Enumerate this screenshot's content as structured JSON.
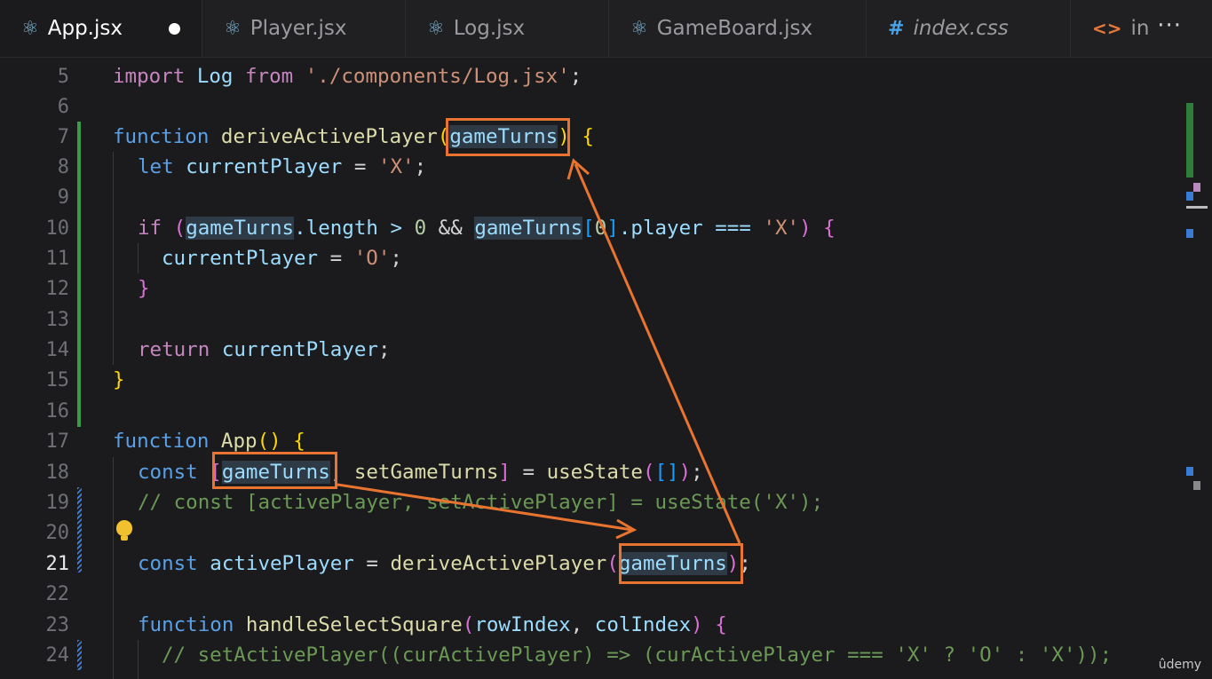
{
  "tabs": [
    {
      "label": "App.jsx",
      "icon": "react-icon",
      "active": true,
      "modified": true
    },
    {
      "label": "Player.jsx",
      "icon": "react-icon"
    },
    {
      "label": "Log.jsx",
      "icon": "react-icon"
    },
    {
      "label": "GameBoard.jsx",
      "icon": "react-icon"
    },
    {
      "label": "index.css",
      "icon": "hash-icon"
    },
    {
      "label": "in",
      "icon": "html-icon"
    }
  ],
  "line_numbers": [
    "5",
    "6",
    "7",
    "8",
    "9",
    "10",
    "11",
    "12",
    "13",
    "14",
    "15",
    "16",
    "17",
    "18",
    "19",
    "20",
    "21",
    "22",
    "23",
    "24"
  ],
  "current_line": "21",
  "code": {
    "l5": {
      "a": "import",
      "b": "Log",
      "c": "from",
      "d": "'./components/Log.jsx'",
      "e": ";"
    },
    "l7": {
      "a": "function",
      "b": "deriveActivePlayer",
      "c": "(",
      "d": "gameTurns",
      "e": ")",
      "f": "{"
    },
    "l8": {
      "a": "let",
      "b": "currentPlayer",
      "c": " = ",
      "d": "'X'",
      "e": ";"
    },
    "l10": {
      "a": "if",
      "b": "(",
      "c": "gameTurns",
      "d": ".length > ",
      "e": "0",
      "f": " && ",
      "g": "gameTurns",
      "h": "[",
      "i": "0",
      "j": "]",
      "k": ".player === ",
      "l": "'X'",
      "m": ")",
      "n": "{"
    },
    "l11": {
      "a": "currentPlayer",
      "b": " = ",
      "c": "'O'",
      "d": ";"
    },
    "l12": {
      "a": "}"
    },
    "l14": {
      "a": "return",
      "b": "currentPlayer",
      "c": ";"
    },
    "l15": {
      "a": "}"
    },
    "l17": {
      "a": "function",
      "b": "App",
      "c": "()",
      "d": "{"
    },
    "l18": {
      "a": "const",
      "b": "[",
      "c": "gameTurns",
      "d": ", ",
      "e": "setGameTurns",
      "f": "]",
      "g": " = ",
      "h": "useState",
      "i": "(",
      "j": "[]",
      "k": ")",
      "l": ";"
    },
    "l19": {
      "a": "// const [activePlayer, setActivePlayer] = useState('X');"
    },
    "l21": {
      "a": "const",
      "b": "activePlayer",
      "c": " = ",
      "d": "deriveActivePlayer",
      "e": "(",
      "f": "gameTurns",
      "g": ")",
      "h": ";"
    },
    "l23": {
      "a": "function",
      "b": "handleSelectSquare",
      "c": "(",
      "d": "rowIndex",
      "e": ", ",
      "f": "colIndex",
      "g": ")",
      "h": "{"
    },
    "l24": {
      "a": "// setActivePlayer((curActivePlayer) => (curActivePlayer === 'X' ? 'O' : 'X'));"
    }
  },
  "more_icon": "···",
  "watermark": "ûdemy",
  "colors": {
    "annotation": "#e8742f",
    "git_added": "#3a9b4b",
    "git_modified": "#3a7bd5"
  }
}
